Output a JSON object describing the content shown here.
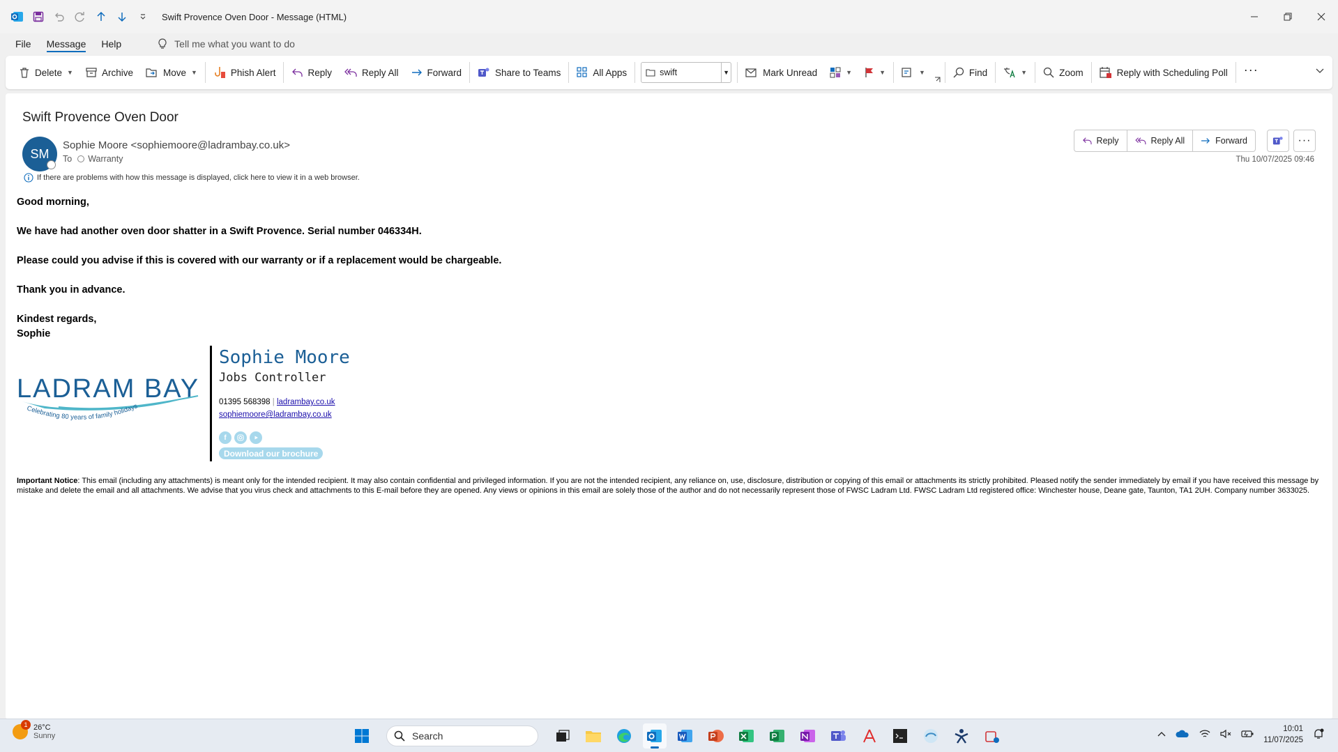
{
  "window": {
    "title": "Swift Provence Oven Door  -  Message (HTML)"
  },
  "menu": {
    "tabs": [
      "File",
      "Message",
      "Help"
    ],
    "tell_me": "Tell me what you want to do"
  },
  "ribbon": {
    "delete": "Delete",
    "archive": "Archive",
    "move": "Move",
    "phish_alert": "Phish Alert",
    "reply": "Reply",
    "reply_all": "Reply All",
    "forward": "Forward",
    "share_teams": "Share to Teams",
    "all_apps": "All Apps",
    "search_value": "swift",
    "mark_unread": "Mark Unread",
    "find": "Find",
    "zoom": "Zoom",
    "scheduling_poll": "Reply with Scheduling Poll"
  },
  "message": {
    "subject": "Swift Provence Oven Door",
    "avatar_initials": "SM",
    "sender": "Sophie Moore <sophiemoore@ladrambay.co.uk>",
    "to_label": "To",
    "to_value": "Warranty",
    "info_bar": "If there are problems with how this message is displayed, click here to view it in a web browser.",
    "date": "Thu 10/07/2025 09:46",
    "actions": {
      "reply": "Reply",
      "reply_all": "Reply All",
      "forward": "Forward"
    },
    "body": {
      "greeting": "Good morning,",
      "p1": "We have had another oven door shatter in a Swift Provence. Serial number 046334H.",
      "p2": "Please could you advise if this is covered with our warranty or if a replacement would be chargeable.",
      "p3": "Thank you in advance.",
      "closing": "Kindest regards,",
      "name": "Sophie"
    },
    "signature": {
      "logo_text": "LADRAM BAY",
      "logo_tagline": "Celebrating 80 years of family holidays",
      "name": "Sophie Moore",
      "role": "Jobs Controller",
      "phone": "01395 568398",
      "website": "ladrambay.co.uk",
      "email": "sophiemoore@ladrambay.co.uk",
      "brochure": "Download our brochure"
    },
    "notice_label": "Important Notice",
    "notice_text": ": This email (including any attachments) is meant only for the intended recipient. It may also contain confidential and privileged information. If you are not the intended recipient, any reliance on, use, disclosure, distribution or copying of this email or attachments its strictly prohibited. Pleased notify the sender immediately by email if you have received this message by mistake and delete the email and all attachments. We advise that you virus check and attachments to this E-mail before they are opened. Any views or opinions in this email are solely those of the author and do not necessarily represent those of FWSC Ladram Ltd. FWSC Ladram Ltd registered office: Winchester house, Deane gate, Taunton, TA1 2UH. Company number 3633025."
  },
  "taskbar": {
    "weather_temp": "26°C",
    "weather_desc": "Sunny",
    "weather_badge": "1",
    "search": "Search",
    "time": "10:01",
    "date": "11/07/2025"
  },
  "colors": {
    "accent": "#0f6cbd",
    "avatar": "#1b5f96",
    "signature_blue": "#1b5f96",
    "social_light_blue": "#a7d8ec"
  }
}
